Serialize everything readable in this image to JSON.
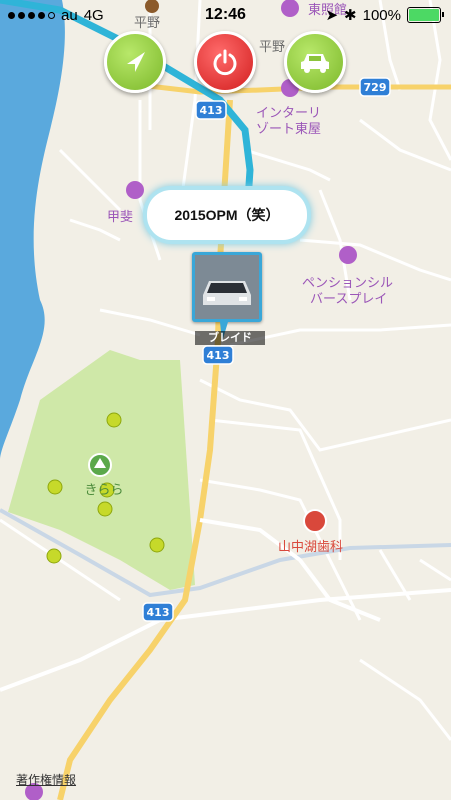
{
  "status_bar": {
    "carrier": "au",
    "network": "4G",
    "time": "12:46",
    "battery_percent": "100%",
    "signal_bars": 4
  },
  "toolbar": {
    "navigate_icon": "navigate-arrow-icon",
    "power_icon": "power-icon",
    "car_icon": "car-icon"
  },
  "map": {
    "labels": {
      "hirano_top": "平野",
      "hirano": "平野",
      "higashi_kan": "東照館",
      "interresort": "インターリ",
      "interresort2": "ゾート東屋",
      "koufu": "甲斐",
      "pension": "ペンションシル",
      "pension2": "バースプレイ",
      "kirara": "きらら",
      "dental": "山中湖歯科"
    },
    "route_shields": {
      "r729": "729",
      "r413_top": "413",
      "r413_mid": "413",
      "r413_bottom": "413"
    },
    "colors": {
      "water": "#5aa9dd",
      "park": "#cfe8a8",
      "route": "#2fb4d8",
      "road_major": "#f7d26a",
      "poi_purple": "#b05fc8",
      "poi_red": "#d9483b"
    }
  },
  "callout": {
    "text": "2015OPM（笑）"
  },
  "vehicle": {
    "label": "ブレイド"
  },
  "footer": {
    "copyright_link": "著作権情報"
  }
}
